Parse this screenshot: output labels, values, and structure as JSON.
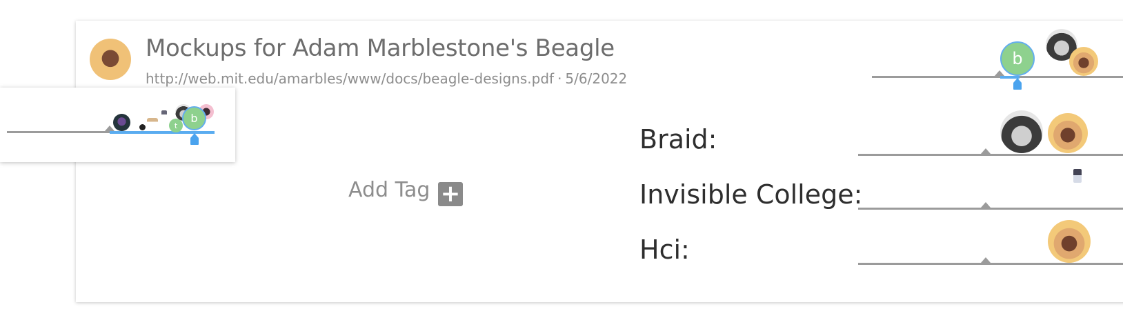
{
  "item": {
    "title": "Mockups for Adam Marblestone's Beagle",
    "url": "http://web.mit.edu/amarbles/www/docs/beagle-designs.pdf",
    "separator": "·",
    "date": "5/6/2022"
  },
  "add_tag": {
    "label": "Add Tag",
    "icon_text": "+"
  },
  "bubble_labels": {
    "main": "b",
    "popup_b": "b",
    "popup_t": "t"
  },
  "tags": [
    {
      "label": "Braid:"
    },
    {
      "label": "Invisible College:"
    },
    {
      "label": "Hci:"
    }
  ],
  "colors": {
    "bubble_green": "#8ed18e",
    "slider_blue": "#5aacf0",
    "track_gray": "#9b9b9b",
    "title_gray": "#6d6d6d"
  },
  "icons": [
    "author-avatar",
    "plus-icon",
    "user-avatar",
    "slider-knob-icon"
  ]
}
